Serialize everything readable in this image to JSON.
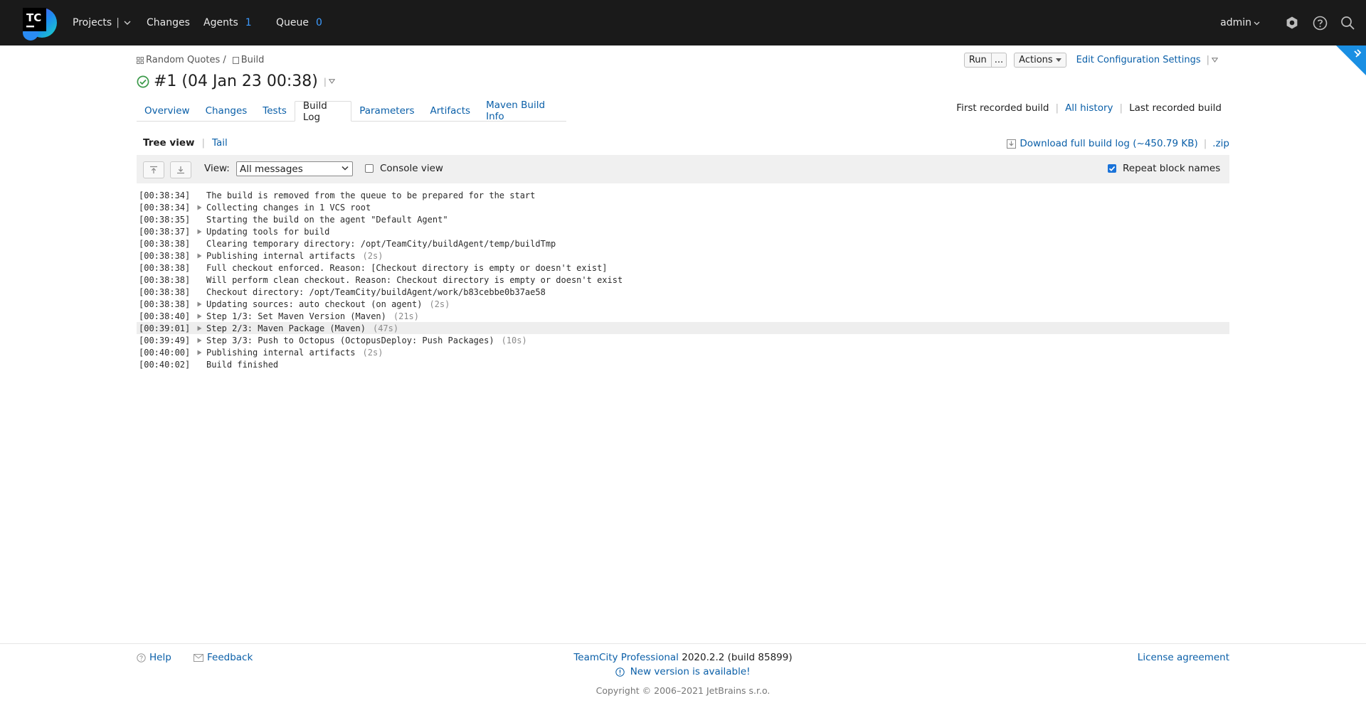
{
  "topbar": {
    "logo_text": "TC",
    "nav": {
      "projects": "Projects",
      "changes": "Changes",
      "agents": "Agents",
      "agents_count": "1",
      "queue": "Queue",
      "queue_count": "0"
    },
    "user": "admin",
    "icons": [
      "settings-icon",
      "help-icon",
      "search-icon"
    ]
  },
  "breadcrumb": {
    "project": "Random Quotes /",
    "config": "Build"
  },
  "build": {
    "title": "#1 (04 Jan 23 00:38)",
    "status": "success"
  },
  "actions": {
    "run": "Run",
    "more": "...",
    "actions": "Actions",
    "edit_settings": "Edit Configuration Settings"
  },
  "tabs": [
    {
      "label": "Overview",
      "active": false
    },
    {
      "label": "Changes",
      "active": false
    },
    {
      "label": "Tests",
      "active": false
    },
    {
      "label": "Build Log",
      "active": true
    },
    {
      "label": "Parameters",
      "active": false
    },
    {
      "label": "Artifacts",
      "active": false
    },
    {
      "label": "Maven Build Info",
      "active": false
    }
  ],
  "history": {
    "first": "First recorded build",
    "all": "All history",
    "last": "Last recorded build"
  },
  "log_view": {
    "tree_view": "Tree view",
    "tail": "Tail",
    "download": "Download full build log (~450.79 KB)",
    "zip": ".zip",
    "view_label": "View:",
    "view_selected": "All messages",
    "console_view": "Console view",
    "console_checked": false,
    "repeat_block_names": "Repeat block names",
    "repeat_checked": true
  },
  "log": [
    {
      "ts": "[00:38:34]",
      "msg": "The build is removed from the queue to be prepared for the start",
      "expandable": false,
      "dur": ""
    },
    {
      "ts": "[00:38:34]",
      "msg": "Collecting changes in 1 VCS root",
      "expandable": true,
      "dur": ""
    },
    {
      "ts": "[00:38:35]",
      "msg": "Starting the build on the agent \"Default Agent\"",
      "expandable": false,
      "dur": ""
    },
    {
      "ts": "[00:38:37]",
      "msg": "Updating tools for build",
      "expandable": true,
      "dur": ""
    },
    {
      "ts": "[00:38:38]",
      "msg": "Clearing temporary directory: /opt/TeamCity/buildAgent/temp/buildTmp",
      "expandable": false,
      "dur": ""
    },
    {
      "ts": "[00:38:38]",
      "msg": "Publishing internal artifacts",
      "expandable": true,
      "dur": "(2s)"
    },
    {
      "ts": "[00:38:38]",
      "msg": "Full checkout enforced. Reason: [Checkout directory is empty or doesn't exist]",
      "expandable": false,
      "dur": ""
    },
    {
      "ts": "[00:38:38]",
      "msg": "Will perform clean checkout. Reason: Checkout directory is empty or doesn't exist",
      "expandable": false,
      "dur": ""
    },
    {
      "ts": "[00:38:38]",
      "msg": "Checkout directory: /opt/TeamCity/buildAgent/work/b83cebbe0b37ae58",
      "expandable": false,
      "dur": ""
    },
    {
      "ts": "[00:38:38]",
      "msg": "Updating sources: auto checkout (on agent)",
      "expandable": true,
      "dur": "(2s)"
    },
    {
      "ts": "[00:38:40]",
      "msg": "Step 1/3: Set Maven Version (Maven)",
      "expandable": true,
      "dur": "(21s)"
    },
    {
      "ts": "[00:39:01]",
      "msg": "Step 2/3: Maven Package (Maven)",
      "expandable": true,
      "dur": "(47s)",
      "highlight": true
    },
    {
      "ts": "[00:39:49]",
      "msg": "Step 3/3: Push to Octopus (OctopusDeploy: Push Packages)",
      "expandable": true,
      "dur": "(10s)"
    },
    {
      "ts": "[00:40:00]",
      "msg": "Publishing internal artifacts",
      "expandable": true,
      "dur": "(2s)"
    },
    {
      "ts": "[00:40:02]",
      "msg": "Build finished",
      "expandable": false,
      "dur": ""
    }
  ],
  "footer": {
    "help": "Help",
    "feedback": "Feedback",
    "product": "TeamCity Professional",
    "version": "2020.2.2 (build 85899)",
    "new_version": "New version is available!",
    "copyright": "Copyright © 2006–2021 JetBrains s.r.o.",
    "license": "License agreement"
  },
  "colors": {
    "topbar_bg": "#1a1a1a",
    "link": "#0a5fa8",
    "count": "#3d9bff",
    "success": "#3c9a4a",
    "accent_corner": "#1a8fe3"
  }
}
